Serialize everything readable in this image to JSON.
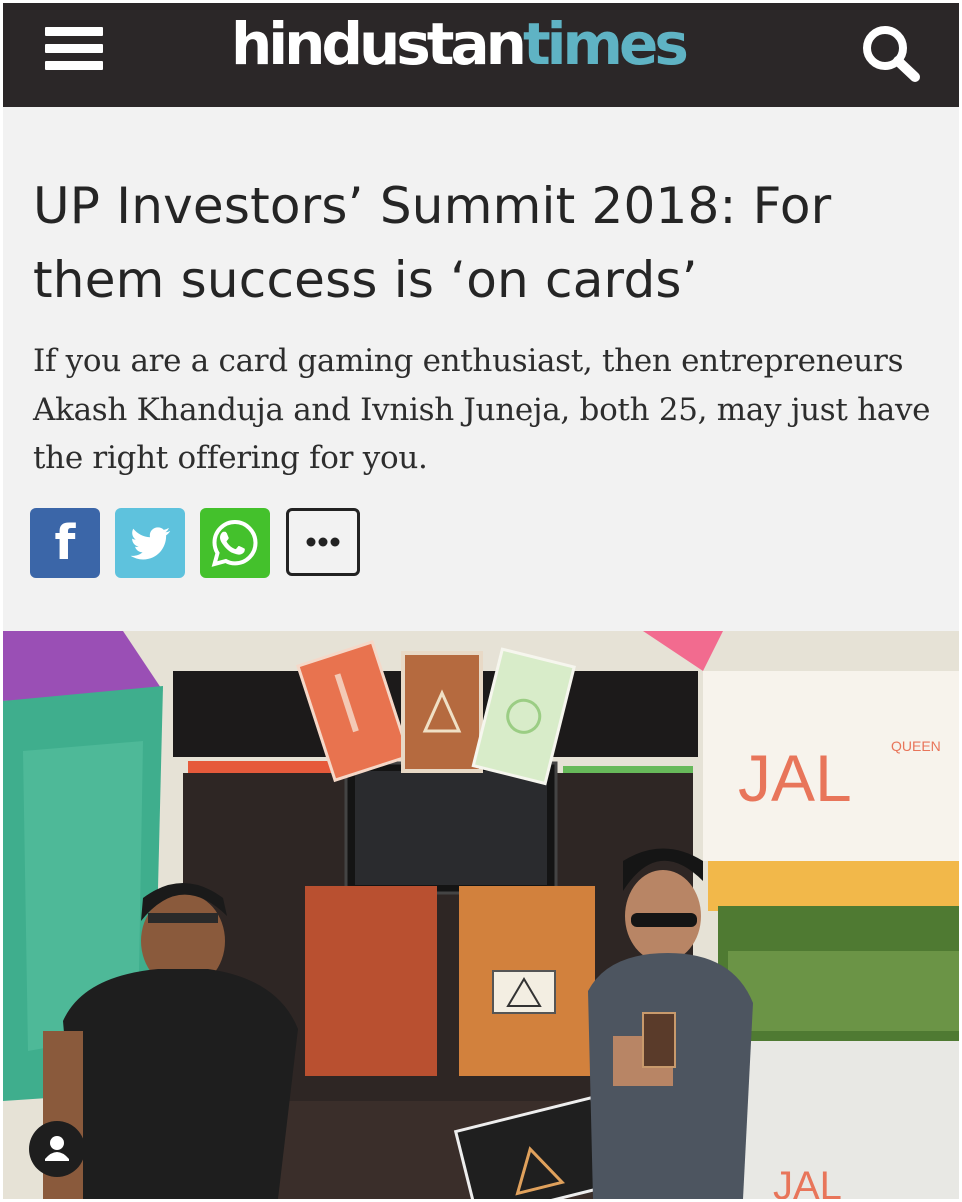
{
  "header": {
    "logo_part1": "hindustan",
    "logo_part2": "times",
    "menu_icon": "hamburger-menu-icon",
    "search_icon": "search-icon"
  },
  "article": {
    "headline": "UP Investors’ Summit 2018: For them success is ‘on cards’",
    "summary": "If you are a card gaming enthusiast, then entrepreneurs Akash Khanduja and Ivnish Juneja, both 25, may just have the right offering for you."
  },
  "share": {
    "facebook_icon": "facebook-icon",
    "twitter_icon": "twitter-icon",
    "whatsapp_icon": "whatsapp-icon",
    "more_icon": "more-options-icon"
  },
  "photo": {
    "sign_text": "JAL",
    "sign_small": "QUEEN",
    "sign_bottom": "JAL"
  },
  "colors": {
    "topbar": "#2b2728",
    "logo_accent": "#5fb3c4",
    "facebook": "#3b66a8",
    "twitter": "#5ec2dd",
    "whatsapp": "#44c12c"
  }
}
